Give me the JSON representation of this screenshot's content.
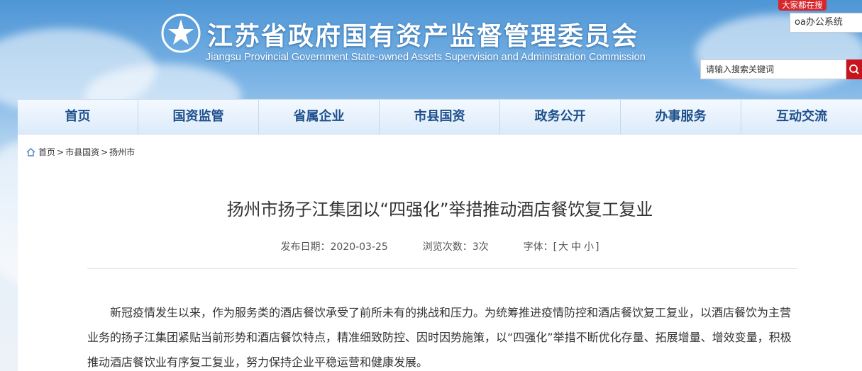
{
  "header": {
    "title": "江苏省政府国有资产监督管理委员会",
    "subtitle": "Jiangsu Provincial Government State-owned Assets Supervision and Administration Commission"
  },
  "hot_search": {
    "tag": "大家都在搜",
    "term": "oa办公系统"
  },
  "search": {
    "placeholder": "请输入搜索关键词"
  },
  "nav": {
    "items": [
      "首页",
      "国资监管",
      "省属企业",
      "市县国资",
      "政务公开",
      "办事服务",
      "互动交流"
    ]
  },
  "breadcrumb": {
    "items": [
      "首页",
      "市县国资",
      "扬州市"
    ],
    "separator": ">"
  },
  "article": {
    "title": "扬州市扬子江集团以“四强化”举措推动酒店餐饮复工复业",
    "date_label": "发布日期：",
    "date": "2020-03-25",
    "views_label": "浏览次数：",
    "views": "3次",
    "font_label": "字体：",
    "font_open": "[",
    "font_large": "大",
    "font_medium": "中",
    "font_small": "小",
    "font_close": "]",
    "paragraph": "新冠疫情发生以来，作为服务类的酒店餐饮承受了前所未有的挑战和压力。为统筹推进疫情防控和酒店餐饮复工复业，以酒店餐饮为主营业务的扬子江集团紧贴当前形势和酒店餐饮特点，精准细致防控、因时因势施策，以“四强化”举措不断优化存量、拓展增量、增效变量，积极推动酒店餐饮业有序复工复业，努力保持企业平稳运营和健康发展。"
  },
  "colors": {
    "nav_text": "#1d4f8c",
    "accent_red": "#c8141c",
    "title_white": "#ffffff"
  }
}
